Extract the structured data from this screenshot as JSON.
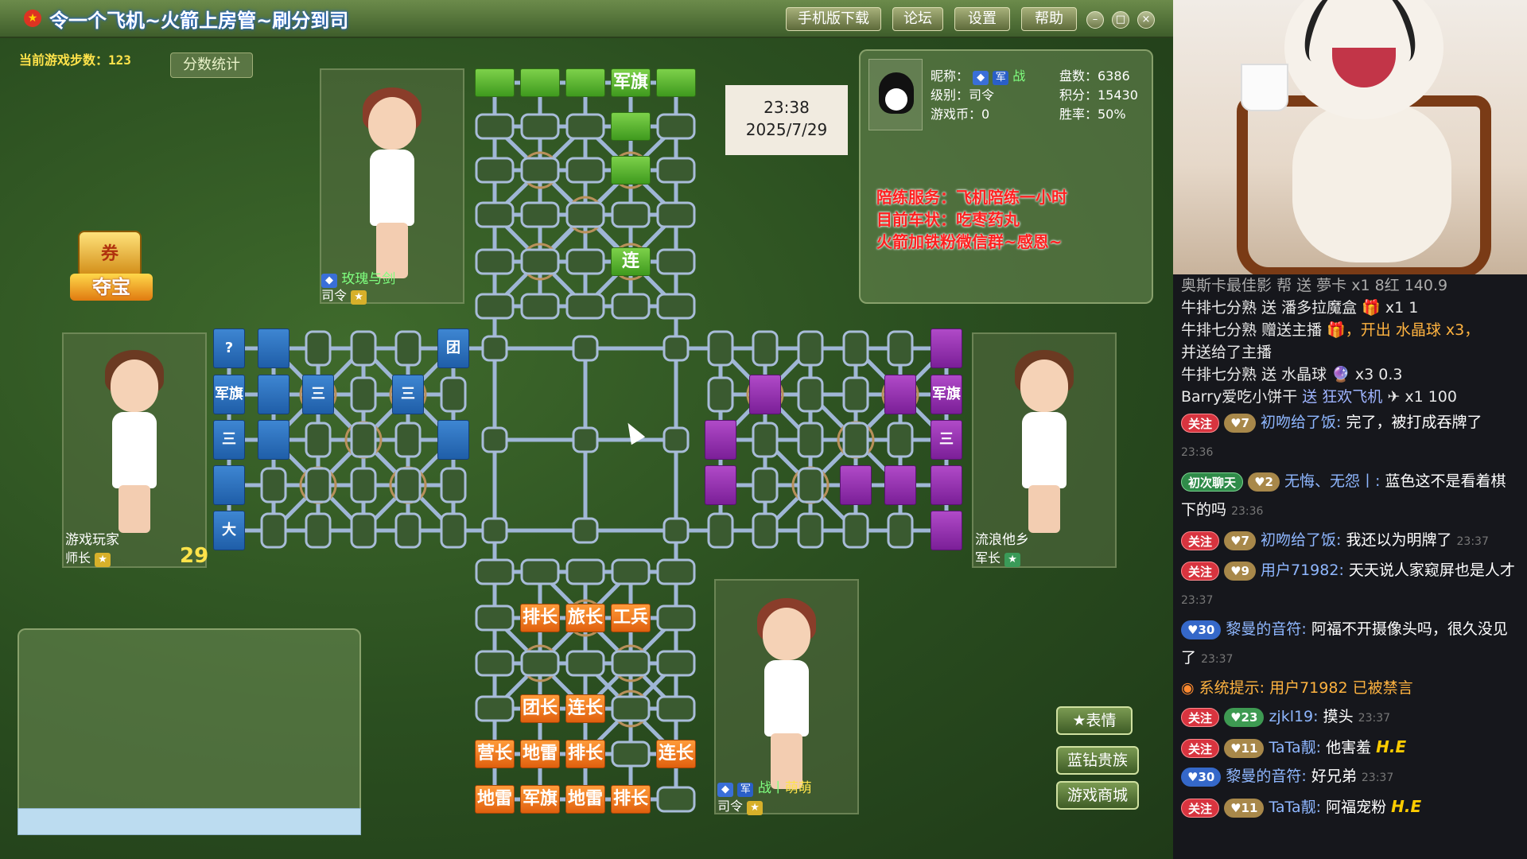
{
  "window": {
    "title": "令一个飞机~火箭上房管~刷分到司",
    "buttons": [
      "手机版下载",
      "论坛",
      "设置",
      "帮助"
    ],
    "controls": [
      "–",
      "□",
      "×"
    ]
  },
  "game": {
    "steps_label": "当前游戏步数：123",
    "score_button": "分数统计",
    "treasure_top": "券",
    "treasure_label": "夺宝",
    "clock_time": "23:38",
    "clock_date": "2025/7/29",
    "cursor_icon": "arrow-cursor"
  },
  "players": {
    "top": {
      "name": "玫瑰与剑",
      "rank": "司令"
    },
    "left": {
      "name": "游戏玩家",
      "rank": "师长",
      "timer": "29"
    },
    "right": {
      "name": "流浪他乡",
      "rank": "军长"
    },
    "bottom": {
      "name": "萌萌",
      "rank": "司令",
      "prefix": "战丨"
    }
  },
  "info": {
    "nick_label": "昵称：",
    "nick_tags": [
      "军",
      "战"
    ],
    "level": "级别：司令",
    "coins": "游戏币：0",
    "rounds": "盘数：6386",
    "points": "积分：15430",
    "winrate": "胜率：50%",
    "ad_lines": [
      "陪练服务：飞机陪练一小时",
      "目前车状：吃枣药丸",
      "火箭加铁粉微信群~感恩~"
    ]
  },
  "pieces": {
    "green": [
      {
        "label": "",
        "col": 0,
        "row": 0
      },
      {
        "label": "",
        "col": 1,
        "row": 0
      },
      {
        "label": "",
        "col": 2,
        "row": 0
      },
      {
        "label": "军旗",
        "col": 3,
        "row": 0
      },
      {
        "label": "",
        "col": 4,
        "row": 0
      },
      {
        "label": "",
        "col": 3,
        "row": 1
      },
      {
        "label": "",
        "col": 3,
        "row": 2
      },
      {
        "label": "连",
        "col": 3,
        "row": 4
      }
    ],
    "orange": [
      {
        "label": "排长",
        "col": 1,
        "row": 1
      },
      {
        "label": "旅长",
        "col": 2,
        "row": 1
      },
      {
        "label": "工兵",
        "col": 3,
        "row": 1
      },
      {
        "label": "团长",
        "col": 1,
        "row": 3
      },
      {
        "label": "连长",
        "col": 2,
        "row": 3
      },
      {
        "label": "营长",
        "col": 0,
        "row": 4
      },
      {
        "label": "地雷",
        "col": 1,
        "row": 4
      },
      {
        "label": "排长",
        "col": 2,
        "row": 4
      },
      {
        "label": "连长",
        "col": 4,
        "row": 4
      },
      {
        "label": "地雷",
        "col": 0,
        "row": 5
      },
      {
        "label": "军旗",
        "col": 1,
        "row": 5
      },
      {
        "label": "地雷",
        "col": 2,
        "row": 5
      },
      {
        "label": "排长",
        "col": 3,
        "row": 5
      }
    ],
    "blue": [
      {
        "label": "?",
        "col": 0,
        "row": 0
      },
      {
        "label": "",
        "col": 1,
        "row": 0
      },
      {
        "label": "团",
        "col": 5,
        "row": 0
      },
      {
        "label": "军旗",
        "col": 0,
        "row": 1
      },
      {
        "label": "",
        "col": 1,
        "row": 1
      },
      {
        "label": "三",
        "col": 2,
        "row": 1
      },
      {
        "label": "三",
        "col": 4,
        "row": 1
      },
      {
        "label": "三",
        "col": 0,
        "row": 2
      },
      {
        "label": "",
        "col": 1,
        "row": 2
      },
      {
        "label": "",
        "col": 5,
        "row": 2
      },
      {
        "label": "",
        "col": 0,
        "row": 3
      },
      {
        "label": "大",
        "col": 0,
        "row": 4
      }
    ],
    "purple": [
      {
        "label": "",
        "col": 5,
        "row": 0
      },
      {
        "label": "",
        "col": 1,
        "row": 1
      },
      {
        "label": "",
        "col": 4,
        "row": 1
      },
      {
        "label": "军旗",
        "col": 5,
        "row": 1
      },
      {
        "label": "",
        "col": 0,
        "row": 2
      },
      {
        "label": "三",
        "col": 5,
        "row": 2
      },
      {
        "label": "",
        "col": 0,
        "row": 3
      },
      {
        "label": "",
        "col": 3,
        "row": 3
      },
      {
        "label": "",
        "col": 4,
        "row": 3
      },
      {
        "label": "",
        "col": 5,
        "row": 3
      },
      {
        "label": "",
        "col": 5,
        "row": 4
      }
    ]
  },
  "side_buttons": [
    "表情",
    "蓝钻贵族",
    "游戏商城"
  ],
  "stream": {
    "gifts": [
      {
        "user": "奥斯卡最佳影",
        "text": "帮 送 夢卡",
        "extra": "x1 8红  140.9"
      },
      {
        "user": "牛排七分熟",
        "text": "送 潘多拉魔盒",
        "extra": "x1  1"
      },
      {
        "user": "牛排七分熟",
        "text": "赠送主播",
        "extra": "，开出 水晶球 x3，"
      },
      {
        "user": "",
        "text": "并送给了主播",
        "extra": ""
      },
      {
        "user": "牛排七分熟",
        "text": "送 水晶球",
        "extra": "x3  0.3"
      },
      {
        "user": "Barry爱吃小饼干",
        "text": "送 狂欢飞机",
        "extra": "x1  100"
      }
    ],
    "messages": [
      {
        "badge": "关注",
        "lv": "7",
        "user": "初吻给了饭:",
        "text": "完了，被打成吞牌了",
        "time": "23:36"
      },
      {
        "badge": "初次聊天",
        "lv": "2",
        "user": "无悔、无怨丨:",
        "text": "蓝色这不是看着棋下的吗",
        "time": "23:36"
      },
      {
        "badge": "关注",
        "lv": "7",
        "user": "初吻给了饭:",
        "text": "我还以为明牌了",
        "time": "23:37"
      },
      {
        "badge": "关注",
        "lv": "9",
        "user": "用户71982:",
        "text": "天天说人家窥屏也是人才",
        "time": "23:37"
      },
      {
        "fan": "30",
        "user": "黎曼的音符:",
        "text": "阿福不开摄像头吗，很久没见了",
        "time": "23:37"
      },
      {
        "system": "系统提示:",
        "text": "用户71982 已被禁言"
      },
      {
        "badge": "关注",
        "lv": "23",
        "user": "zjkl19:",
        "text": "摸头",
        "time": "23:37"
      },
      {
        "badge": "关注",
        "lv": "11",
        "user": "TaTa靓:",
        "text": "他害羞",
        "he": "H.E"
      },
      {
        "fan": "30",
        "user": "黎曼的音符:",
        "text": "好兄弟",
        "time": "23:37"
      },
      {
        "badge": "关注",
        "lv": "11",
        "user": "TaTa靓:",
        "text": "阿福宠粉",
        "he": "H.E"
      }
    ]
  }
}
